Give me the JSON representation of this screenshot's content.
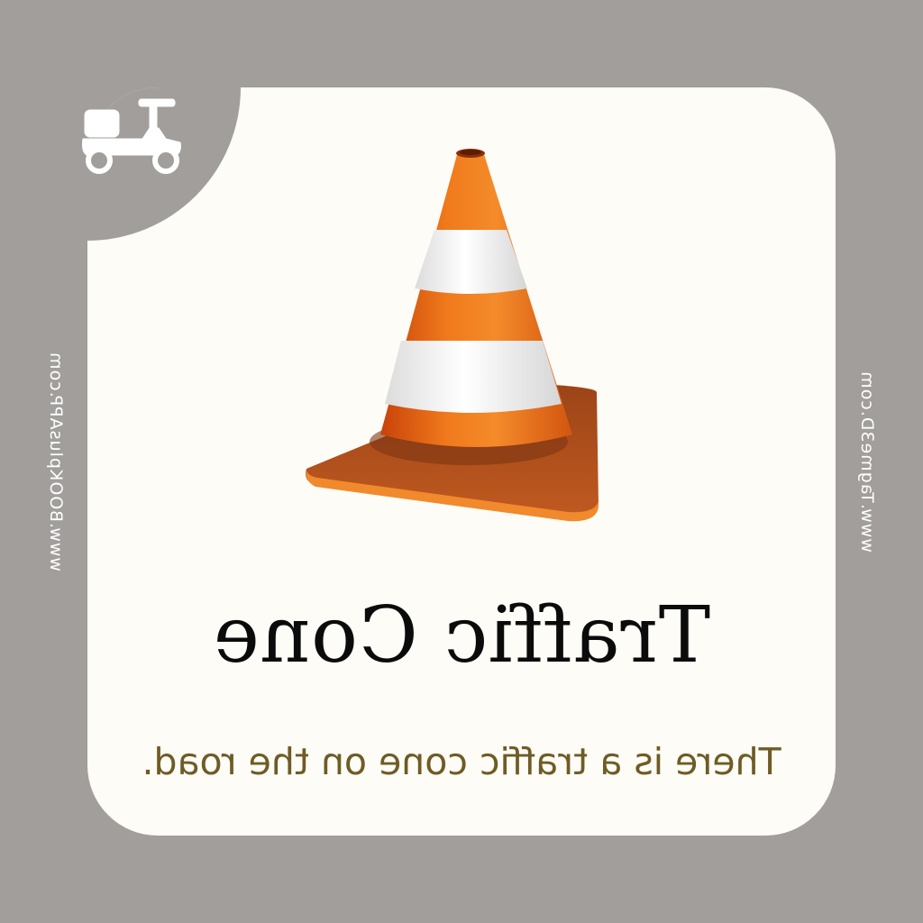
{
  "card": {
    "title": "Traffic Cone",
    "caption": "There is a traffic cone on the road."
  },
  "side_text": {
    "left": "www.BOOKplusAPP.com",
    "right": "www.Tagme3D.com"
  },
  "icons": {
    "corner": "scooter-icon",
    "main": "traffic-cone-icon"
  },
  "colors": {
    "background": "#a19e9b",
    "card": "#fdfcf6",
    "cone_orange": "#e8620f",
    "cone_base": "#b9501c",
    "stripe": "#f2f2f2",
    "title": "#0b0b0b",
    "caption": "#6f5b25"
  }
}
